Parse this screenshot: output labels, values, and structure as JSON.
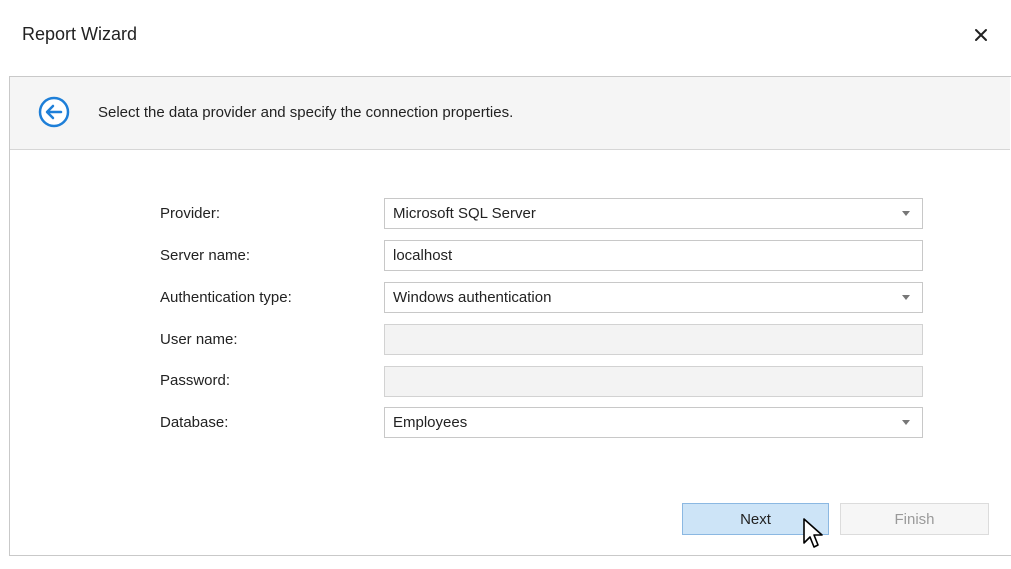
{
  "window": {
    "title": "Report Wizard",
    "close_icon": "close-icon"
  },
  "header": {
    "back_icon": "back-arrow-icon",
    "instruction": "Select the data provider and specify the connection properties.",
    "accent_color": "#1e7fd8"
  },
  "form": {
    "provider": {
      "label": "Provider:",
      "value": "Microsoft SQL Server"
    },
    "server_name": {
      "label": "Server name:",
      "value": "localhost"
    },
    "authentication_type": {
      "label": "Authentication type:",
      "value": "Windows authentication"
    },
    "user_name": {
      "label": "User name:",
      "value": ""
    },
    "password": {
      "label": "Password:",
      "value": ""
    },
    "database": {
      "label": "Database:",
      "value": "Employees"
    }
  },
  "buttons": {
    "next": "Next",
    "finish": "Finish"
  }
}
